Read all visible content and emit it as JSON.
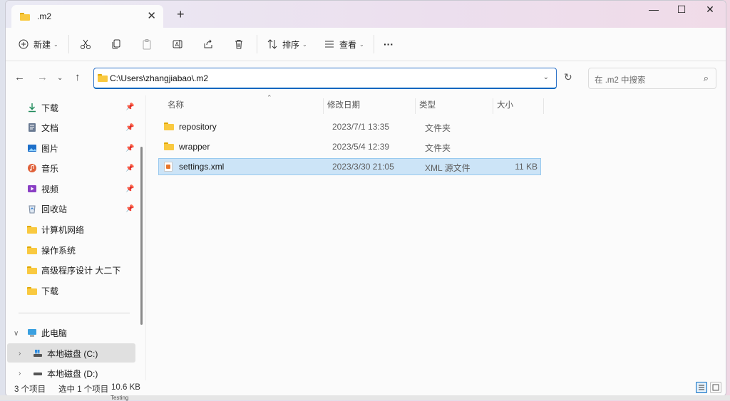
{
  "window": {
    "tab_title": ".m2",
    "tab_close": "✕",
    "new_tab": "+",
    "minimize": "—",
    "maximize": "☐",
    "close": "✕"
  },
  "toolbar": {
    "new_label": "新建",
    "sort_label": "排序",
    "view_label": "查看",
    "more_label": "···"
  },
  "nav": {
    "address": "C:\\Users\\zhangjiabao\\.m2",
    "search_placeholder": "在 .m2 中搜索"
  },
  "sidebar": {
    "items": [
      {
        "label": "下载",
        "icon": "download-icon",
        "pinned": true
      },
      {
        "label": "文档",
        "icon": "document-icon",
        "pinned": true
      },
      {
        "label": "图片",
        "icon": "picture-icon",
        "pinned": true
      },
      {
        "label": "音乐",
        "icon": "music-icon",
        "pinned": true
      },
      {
        "label": "视频",
        "icon": "video-icon",
        "pinned": true
      },
      {
        "label": "回收站",
        "icon": "recycle-bin-icon",
        "pinned": true
      },
      {
        "label": "计算机网络",
        "icon": "folder-icon",
        "pinned": false
      },
      {
        "label": "操作系统",
        "icon": "folder-icon",
        "pinned": false
      },
      {
        "label": "高级程序设计 大二下",
        "icon": "folder-icon",
        "pinned": false
      },
      {
        "label": "下载",
        "icon": "folder-icon",
        "pinned": false
      }
    ],
    "this_pc": "此电脑",
    "drive_c": "本地磁盘 (C:)",
    "drive_d": "本地磁盘 (D:)"
  },
  "columns": {
    "name": "名称",
    "modified": "修改日期",
    "type": "类型",
    "size": "大小"
  },
  "files": [
    {
      "name": "repository",
      "modified": "2023/7/1 13:35",
      "type": "文件夹",
      "size": "",
      "kind": "folder"
    },
    {
      "name": "wrapper",
      "modified": "2023/5/4 12:39",
      "type": "文件夹",
      "size": "",
      "kind": "folder"
    },
    {
      "name": "settings.xml",
      "modified": "2023/3/30 21:05",
      "type": "XML 源文件",
      "size": "11 KB",
      "kind": "xml",
      "selected": true
    }
  ],
  "status": {
    "count": "3 个项目",
    "selection": "选中 1 个项目",
    "selection_size": "10.6 KB"
  },
  "taskbar_hint": "Testing",
  "colors": {
    "accent": "#0067c0",
    "selection_bg": "#cce4f7",
    "folder": "#f9c940"
  }
}
